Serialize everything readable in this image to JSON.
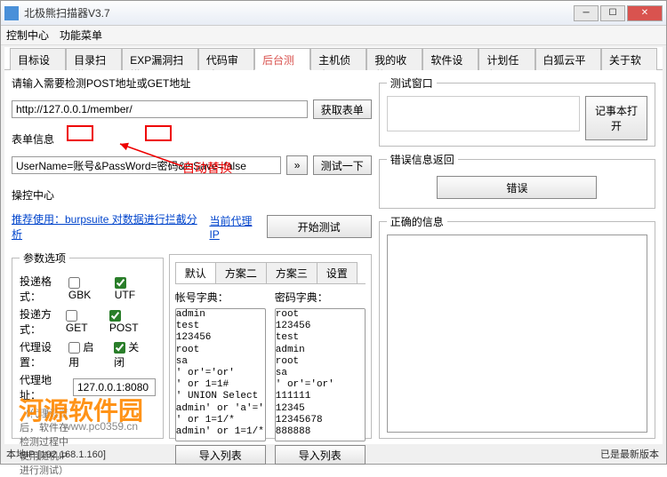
{
  "window": {
    "title": "北极熊扫描器V3.7"
  },
  "menu": {
    "control": "控制中心",
    "funcs": "功能菜单"
  },
  "tabs": [
    "目标设定",
    "目录扫描",
    "EXP漏洞扫描",
    "代码审计",
    "后台测试",
    "主机侦查",
    "我的收藏",
    "软件设置",
    "计划任务",
    "白狐云平台",
    "关于软件"
  ],
  "activeTabIndex": 4,
  "url_section": {
    "label": "请输入需要检测POST地址或GET地址",
    "url": "http://127.0.0.1/member/",
    "btn": "获取表单"
  },
  "form_section": {
    "label": "表单信息",
    "value": "UserName=账号&PassWord=密码&isSave=false",
    "more": "»",
    "test": "测试一下"
  },
  "control_section": {
    "label": "操控中心",
    "recommend": "推荐使用：burpsuite 对数据进行拦截分析",
    "proxy_label": "当前代理IP",
    "start": "开始测试"
  },
  "annotation": "自动替换",
  "params": {
    "legend": "参数选项",
    "format_lbl": "投递格式：",
    "method_lbl": "投递方式：",
    "proxyset_lbl": "代理设置：",
    "proxyaddr_lbl": "代理地址：",
    "gbk": "GBK",
    "utf": "UTF",
    "get": "GET",
    "post": "POST",
    "enable": "启用",
    "disable": "关闭",
    "proxy_addr": "127.0.0.1:8080",
    "hint": "（代理设置后，软件在检测过程中使用随机IP进行测试）"
  },
  "subtabs": [
    "默认",
    "方案二",
    "方案三",
    "设置"
  ],
  "dict": {
    "user_lbl": "帐号字典：",
    "pass_lbl": "密码字典：",
    "import": "导入列表",
    "users": [
      "admin",
      "test",
      "123456",
      "root",
      "sa",
      "' or'='or'",
      "' or 1=1#",
      "' UNION Select",
      "admin' or 'a'='",
      "' or 1=1/*",
      "admin' or 1=1/*"
    ],
    "passes": [
      "root",
      "123456",
      "test",
      "admin",
      "root",
      "sa",
      "' or'='or'",
      "111111",
      "12345",
      "12345678",
      "888888",
      ""
    ]
  },
  "right": {
    "testwin": "测试窗口",
    "notepad": "记事本打开",
    "err_title": "错误信息返回",
    "err_btn": "错误",
    "correct": "正确的信息"
  },
  "status": {
    "ip": "本地IP:[192.168.1.160]",
    "newver": "已是最新版本"
  },
  "watermark": {
    "name": "河源软件园",
    "url": "www.pc0359.cn"
  }
}
